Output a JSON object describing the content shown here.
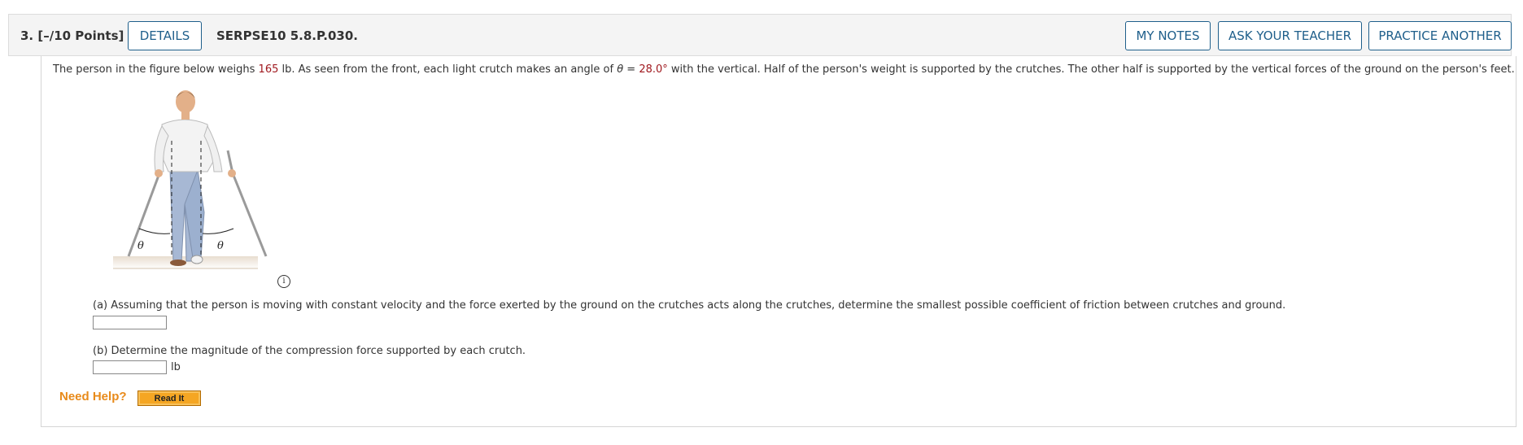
{
  "header": {
    "question_number": "3.",
    "points": "[–/10 Points]",
    "details_label": "DETAILS",
    "problem_code": "SERPSE10 5.8.P.030.",
    "my_notes_label": "MY NOTES",
    "ask_teacher_label": "ASK YOUR TEACHER",
    "practice_another_label": "PRACTICE ANOTHER"
  },
  "problem": {
    "text_1": "The person in the figure below weighs ",
    "weight": "165",
    "text_2": " lb. As seen from the front, each light crutch makes an angle of ",
    "theta_symbol": "θ",
    "text_3": " = ",
    "angle": "28.0°",
    "text_4": " with the vertical. Half of the person's weight is supported by the crutches. The other half is supported by the vertical forces of the ground on the person's feet."
  },
  "figure": {
    "theta_left": "θ",
    "theta_right": "θ",
    "info_glyph": "i"
  },
  "parts": {
    "a_text": "(a) Assuming that the person is moving with constant velocity and the force exerted by the ground on the crutches acts along the crutches, determine the smallest possible coefficient of friction between crutches and ground.",
    "a_value": "",
    "b_text": "(b) Determine the magnitude of the compression force supported by each crutch.",
    "b_value": "",
    "b_unit": "lb"
  },
  "help": {
    "need_help_label": "Need Help?",
    "read_it_label": "Read It"
  },
  "colors": {
    "accent_blue": "#1f5f8b",
    "value_red": "#a0191f",
    "help_orange": "#e88a1a",
    "button_orange": "#f5a623"
  }
}
